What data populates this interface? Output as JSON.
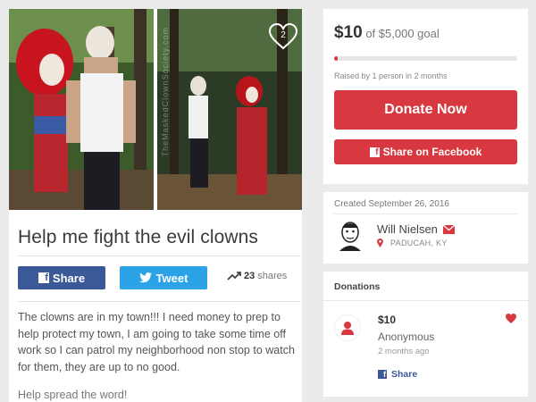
{
  "campaign": {
    "title": "Help me fight the evil clowns",
    "story": "The clowns are in my town!!! I need money to prep to help protect my town, I am going to take some time off work so I can patrol my neighborhood non stop to watch for them, they are up to no good.",
    "story_more": "Help spread the word!",
    "heart_count": "2",
    "watermark": "TheMaskedClownSociety.com"
  },
  "share_bar": {
    "facebook_label": "Share",
    "twitter_label": "Tweet",
    "shares_count": "23",
    "shares_label": "shares"
  },
  "goal": {
    "raised": "$10",
    "goal_text": "of $5,000 goal",
    "progress_fraction": 0.02,
    "raised_by": "Raised by 1 person in 2 months",
    "donate_label": "Donate Now",
    "share_facebook_label": "Share on Facebook"
  },
  "organizer": {
    "created": "Created September 26, 2016",
    "name": "Will Nielsen",
    "location": "PADUCAH, KY"
  },
  "donations": {
    "header": "Donations",
    "items": [
      {
        "amount": "$10",
        "name": "Anonymous",
        "time": "2 months ago",
        "share_label": "Share"
      }
    ]
  },
  "colors": {
    "accent_red": "#d8383f",
    "facebook_blue": "#3b5998",
    "twitter_blue": "#2ba3e6"
  },
  "icons": [
    "heart-outline-icon",
    "facebook-icon",
    "twitter-icon",
    "trending-icon",
    "envelope-icon",
    "map-pin-icon",
    "person-icon",
    "heart-icon"
  ]
}
